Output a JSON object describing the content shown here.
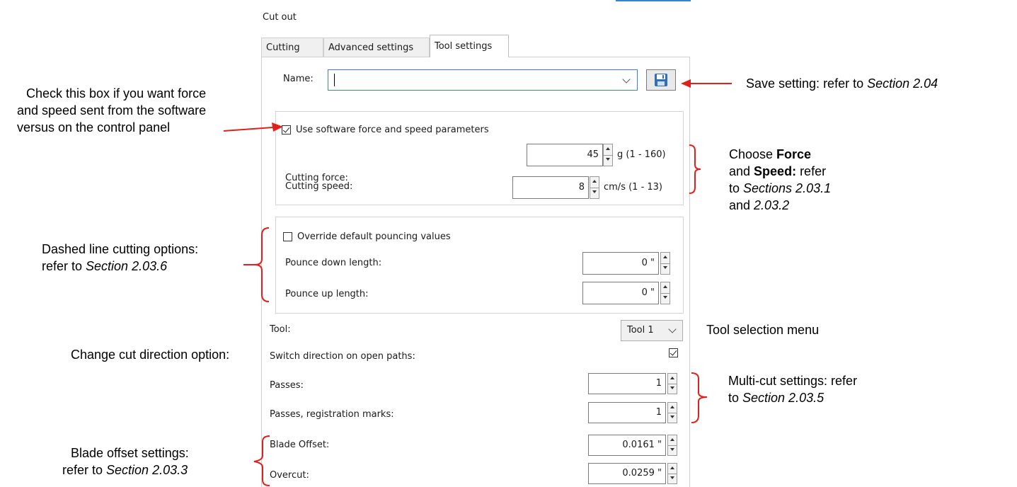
{
  "window": {
    "title": "Cut out"
  },
  "tabs": [
    {
      "label": "Cutting",
      "active": false
    },
    {
      "label": "Advanced settings",
      "active": false
    },
    {
      "label": "Tool settings",
      "active": true
    }
  ],
  "name_field": {
    "label": "Name:",
    "value": ""
  },
  "force_speed": {
    "checkbox_label": "Use software force and speed parameters",
    "checked": true,
    "cutting_force": {
      "label": "Cutting force:",
      "value": "45",
      "unit": "g (1 - 160)"
    },
    "cutting_speed": {
      "label": "Cutting speed:",
      "value": "8",
      "unit": "cm/s (1 - 13)"
    }
  },
  "pouncing": {
    "checkbox_label": "Override default pouncing values",
    "checked": false,
    "down": {
      "label": "Pounce down length:",
      "value": "0 \""
    },
    "up": {
      "label": "Pounce up length:",
      "value": "0 \""
    }
  },
  "tool": {
    "label": "Tool:",
    "value": "Tool 1"
  },
  "switch_direction": {
    "label": "Switch direction on open paths:",
    "checked": true
  },
  "passes": {
    "label": "Passes:",
    "value": "1"
  },
  "passes_reg": {
    "label": "Passes, registration marks:",
    "value": "1"
  },
  "blade_offset": {
    "label": "Blade Offset:",
    "value": "0.0161 \""
  },
  "overcut": {
    "label": "Overcut:",
    "value": "0.0259 \""
  },
  "annotations": {
    "save_prefix": "Save setting: refer to ",
    "save_ref": "Section 2.04",
    "checkbox_line1": "Check this box if you want force",
    "checkbox_line2": "and speed sent from the software",
    "checkbox_line3": "versus on the control panel",
    "choose_1a": "Choose ",
    "choose_1b": "Force",
    "choose_2a": "and ",
    "choose_2b": "Speed:",
    "choose_2c": " refer",
    "choose_3a": "to ",
    "choose_3b": "Sections 2.03.1",
    "choose_4a": "and ",
    "choose_4b": "2.03.2",
    "dashed_line1": "Dashed line cutting options:",
    "dashed_line2a": "refer to ",
    "dashed_line2b": "Section 2.03.6",
    "tool_menu": "Tool selection menu",
    "cut_direction": "Change cut direction option:",
    "multicut_line1": "Multi-cut settings: refer",
    "multicut_line2a": "to ",
    "multicut_line2b": "Section 2.03.5",
    "blade_line1": "Blade offset settings:",
    "blade_line2a": "refer to ",
    "blade_line2b": "Section 2.03.3"
  },
  "colors": {
    "annotation_red": "#e0201c",
    "focus_blue": "#3c7fd1",
    "save_icon_blue": "#2e6fb8"
  },
  "icons": {
    "save": "floppy-disk-icon",
    "dropdown": "chevron-down-icon",
    "spinner": "spin-arrows-icon",
    "check": "checkmark-icon"
  }
}
